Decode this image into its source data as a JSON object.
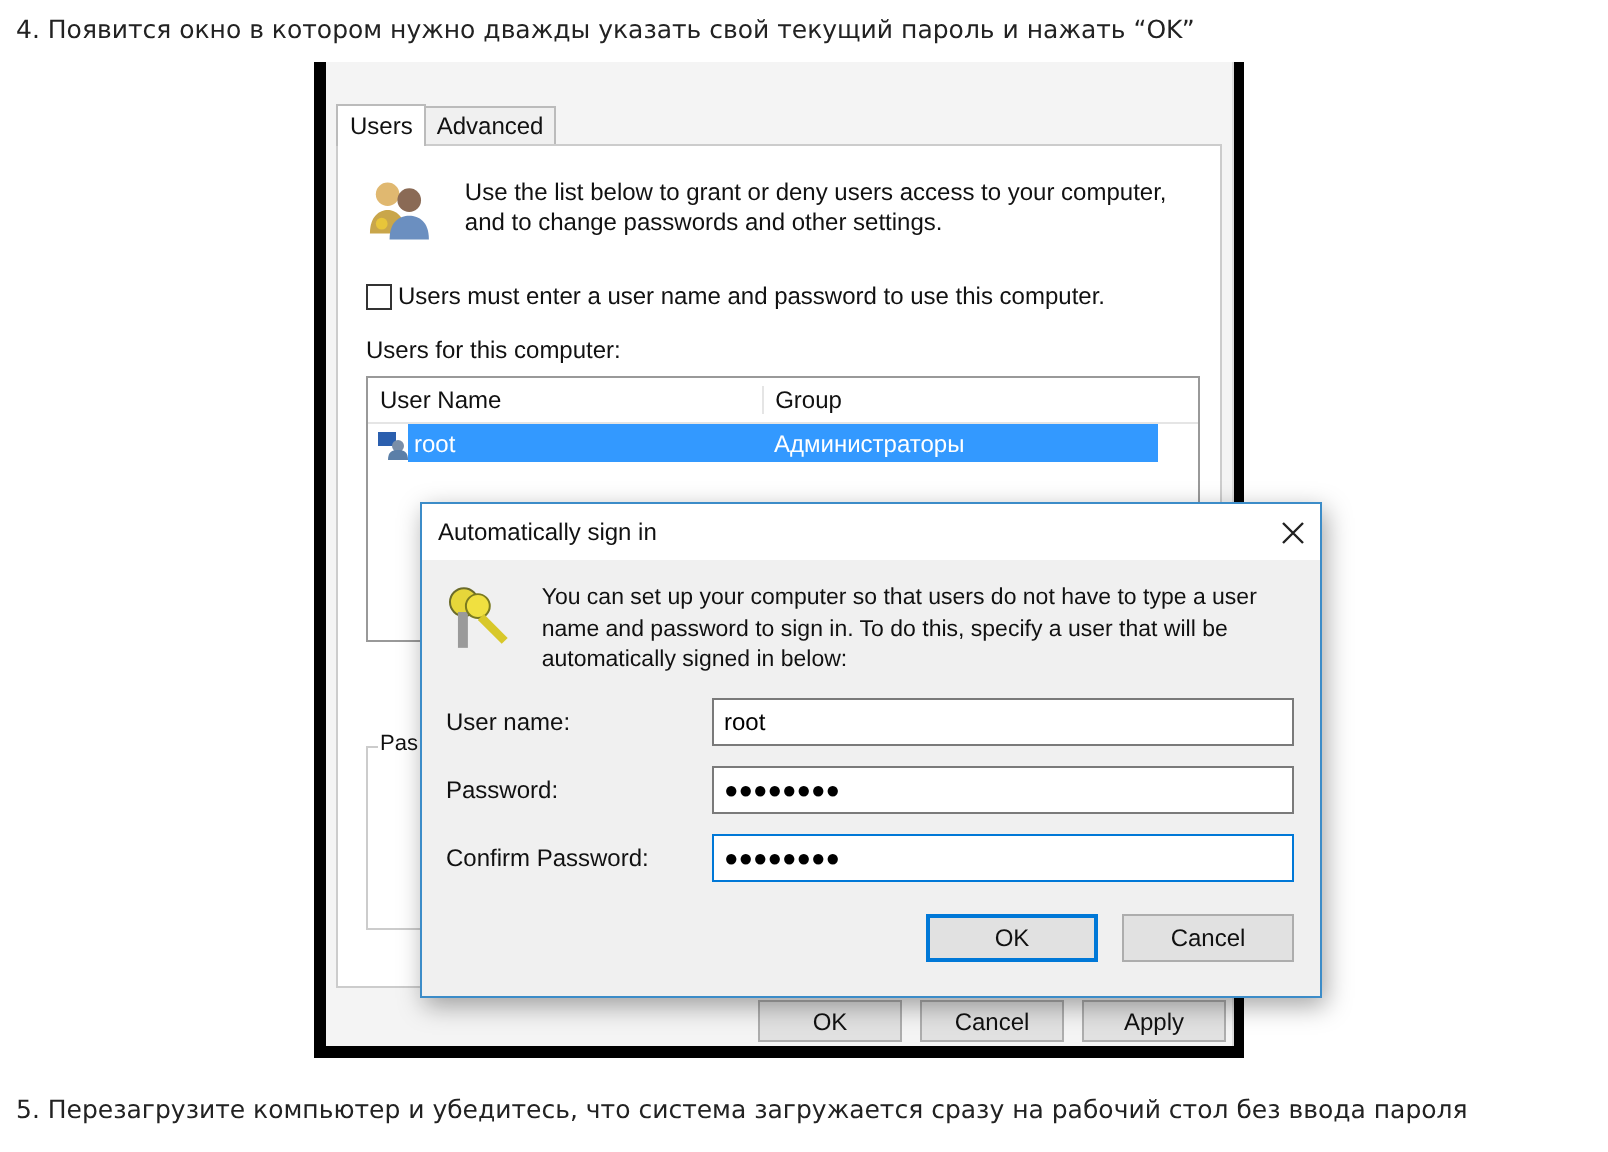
{
  "article": {
    "step_before": "4. Появится окно в котором нужно дважды указать свой текущий пароль и нажать “OK”",
    "step_after": "5. Перезагрузите компьютер и убедитесь, что система загружается сразу на рабочий стол без ввода пароля"
  },
  "user_accounts": {
    "tabs": [
      {
        "label": "Users",
        "selected": true
      },
      {
        "label": "Advanced",
        "selected": false
      }
    ],
    "intro": "Use the list below to grant or deny users access to your computer, and to change passwords and other settings.",
    "require_login": {
      "label": "Users must enter a user name and password to use this computer.",
      "checked": false
    },
    "list_label": "Users for this computer:",
    "columns": [
      "User Name",
      "Group"
    ],
    "rows": [
      {
        "user_name": "root",
        "group": "Администраторы",
        "selected": true
      }
    ],
    "group_label": "Pas",
    "buttons": [
      "OK",
      "Cancel",
      "Apply"
    ]
  },
  "dialog": {
    "title": "Automatically sign in",
    "message": "You can set up your computer so that users do not have to type a user name and password to sign in. To do this, specify a user that will be automatically signed in below:",
    "fields": [
      {
        "label": "User name:",
        "value": "root",
        "focused": false
      },
      {
        "label": "Password:",
        "value": "●●●●●●●●",
        "focused": false
      },
      {
        "label": "Confirm Password:",
        "value": "●●●●●●●●",
        "focused": true
      }
    ],
    "buttons": [
      {
        "label": "OK",
        "default": true
      },
      {
        "label": "Cancel",
        "default": false
      }
    ]
  }
}
